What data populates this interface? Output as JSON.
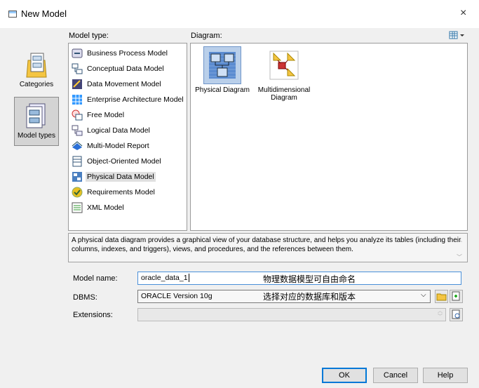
{
  "window": {
    "title": "New Model",
    "close_glyph": "×"
  },
  "sidebar": {
    "items": [
      {
        "label": "Categories",
        "icon": "categories-icon",
        "selected": false
      },
      {
        "label": "Model types",
        "icon": "model-types-icon",
        "selected": true
      }
    ]
  },
  "model_type": {
    "label": "Model type:",
    "items": [
      {
        "label": "Business Process Model",
        "icon": "business-process-icon"
      },
      {
        "label": "Conceptual Data Model",
        "icon": "conceptual-data-icon"
      },
      {
        "label": "Data Movement Model",
        "icon": "data-movement-icon"
      },
      {
        "label": "Enterprise Architecture Model",
        "icon": "enterprise-architecture-icon"
      },
      {
        "label": "Free Model",
        "icon": "free-model-icon"
      },
      {
        "label": "Logical Data Model",
        "icon": "logical-data-icon"
      },
      {
        "label": "Multi-Model Report",
        "icon": "multi-model-report-icon"
      },
      {
        "label": "Object-Oriented Model",
        "icon": "object-oriented-icon"
      },
      {
        "label": "Physical Data Model",
        "icon": "physical-data-icon",
        "selected": true
      },
      {
        "label": "Requirements Model",
        "icon": "requirements-icon"
      },
      {
        "label": "XML Model",
        "icon": "xml-model-icon"
      }
    ]
  },
  "diagram": {
    "label": "Diagram:",
    "view_icon": "view-options-icon",
    "items": [
      {
        "label": "Physical Diagram",
        "selected": true
      },
      {
        "label": "Multidimensional Diagram"
      }
    ]
  },
  "description": "A physical data diagram provides a graphical view of your database structure, and helps you analyze its tables (including their columns, indexes, and triggers), views, and procedures, and the references between them.",
  "form": {
    "model_name_label": "Model name:",
    "model_name_value": "oracle_data_1",
    "model_name_note": "物理数据模型可自由命名",
    "dbms_label": "DBMS:",
    "dbms_value": "ORACLE Version 10g",
    "dbms_note": "选择对应的数据库和版本",
    "extensions_label": "Extensions:",
    "extensions_value": ""
  },
  "buttons": {
    "ok": "OK",
    "cancel": "Cancel",
    "help": "Help"
  }
}
